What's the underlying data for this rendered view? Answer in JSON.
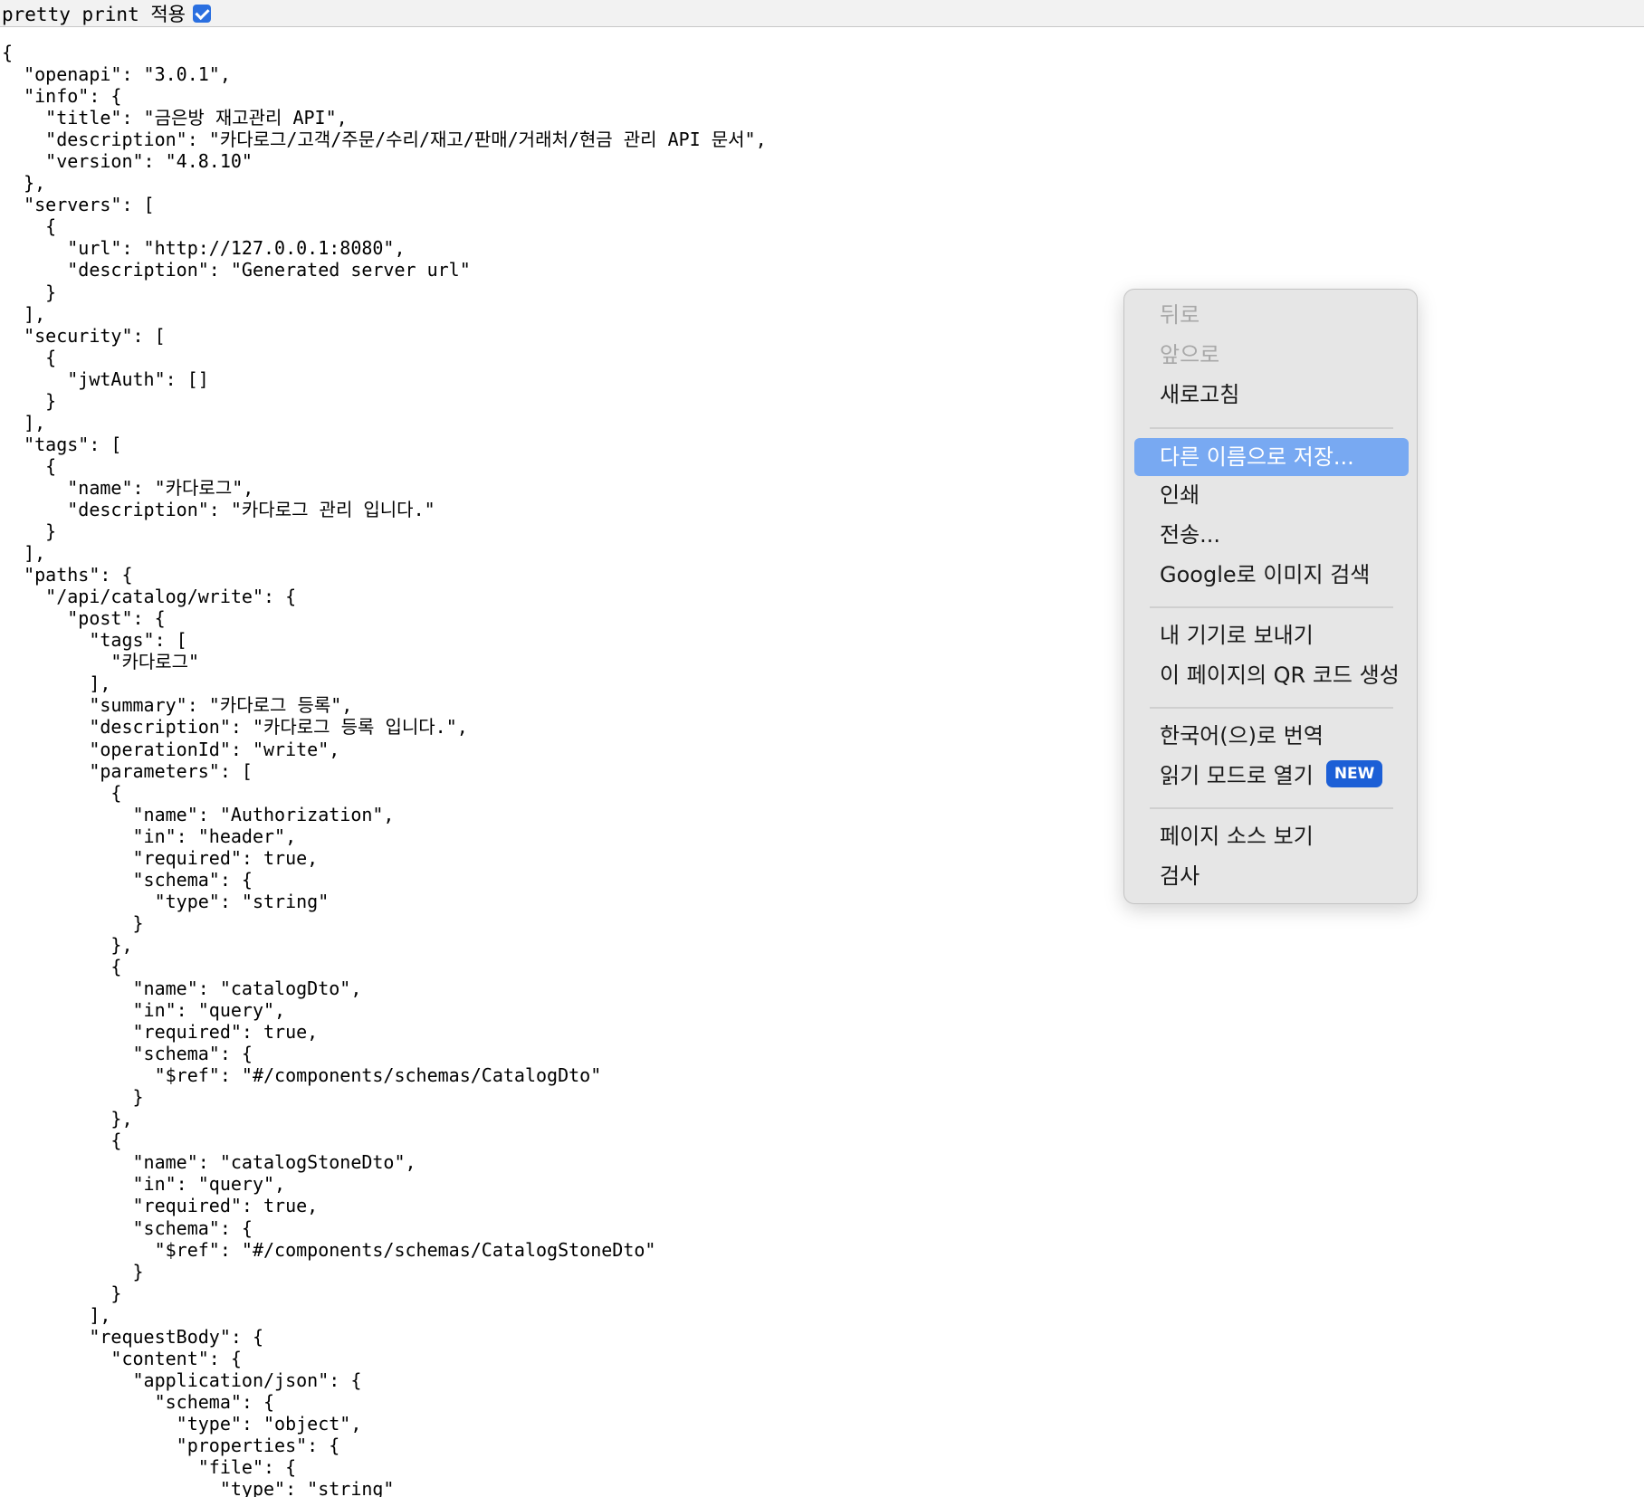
{
  "toolbar": {
    "label": "pretty print 적용",
    "checked": true
  },
  "json_text": "{\n  \"openapi\": \"3.0.1\",\n  \"info\": {\n    \"title\": \"금은방 재고관리 API\",\n    \"description\": \"카다로그/고객/주문/수리/재고/판매/거래처/현금 관리 API 문서\",\n    \"version\": \"4.8.10\"\n  },\n  \"servers\": [\n    {\n      \"url\": \"http://127.0.0.1:8080\",\n      \"description\": \"Generated server url\"\n    }\n  ],\n  \"security\": [\n    {\n      \"jwtAuth\": []\n    }\n  ],\n  \"tags\": [\n    {\n      \"name\": \"카다로그\",\n      \"description\": \"카다로그 관리 입니다.\"\n    }\n  ],\n  \"paths\": {\n    \"/api/catalog/write\": {\n      \"post\": {\n        \"tags\": [\n          \"카다로그\"\n        ],\n        \"summary\": \"카다로그 등록\",\n        \"description\": \"카다로그 등록 입니다.\",\n        \"operationId\": \"write\",\n        \"parameters\": [\n          {\n            \"name\": \"Authorization\",\n            \"in\": \"header\",\n            \"required\": true,\n            \"schema\": {\n              \"type\": \"string\"\n            }\n          },\n          {\n            \"name\": \"catalogDto\",\n            \"in\": \"query\",\n            \"required\": true,\n            \"schema\": {\n              \"$ref\": \"#/components/schemas/CatalogDto\"\n            }\n          },\n          {\n            \"name\": \"catalogStoneDto\",\n            \"in\": \"query\",\n            \"required\": true,\n            \"schema\": {\n              \"$ref\": \"#/components/schemas/CatalogStoneDto\"\n            }\n          }\n        ],\n        \"requestBody\": {\n          \"content\": {\n            \"application/json\": {\n              \"schema\": {\n                \"type\": \"object\",\n                \"properties\": {\n                  \"file\": {\n                    \"type\": \"string\"",
  "context_menu": {
    "items": [
      {
        "label": "뒤로",
        "disabled": true
      },
      {
        "label": "앞으로",
        "disabled": true
      },
      {
        "label": "새로고침"
      },
      {
        "label": "다른 이름으로 저장...",
        "selected": true
      },
      {
        "label": "인쇄"
      },
      {
        "label": "전송..."
      },
      {
        "label": "Google로 이미지 검색"
      },
      {
        "label": "내 기기로 보내기"
      },
      {
        "label": "이 페이지의 QR 코드 생성"
      },
      {
        "label": "한국어(으)로 번역"
      },
      {
        "label": "읽기 모드로 열기",
        "badge": "NEW"
      },
      {
        "label": "페이지 소스 보기"
      },
      {
        "label": "검사"
      }
    ]
  },
  "colors": {
    "selection": "#78a9f2",
    "badge": "#1c5fd6",
    "checkbox": "#2a6fe0"
  }
}
